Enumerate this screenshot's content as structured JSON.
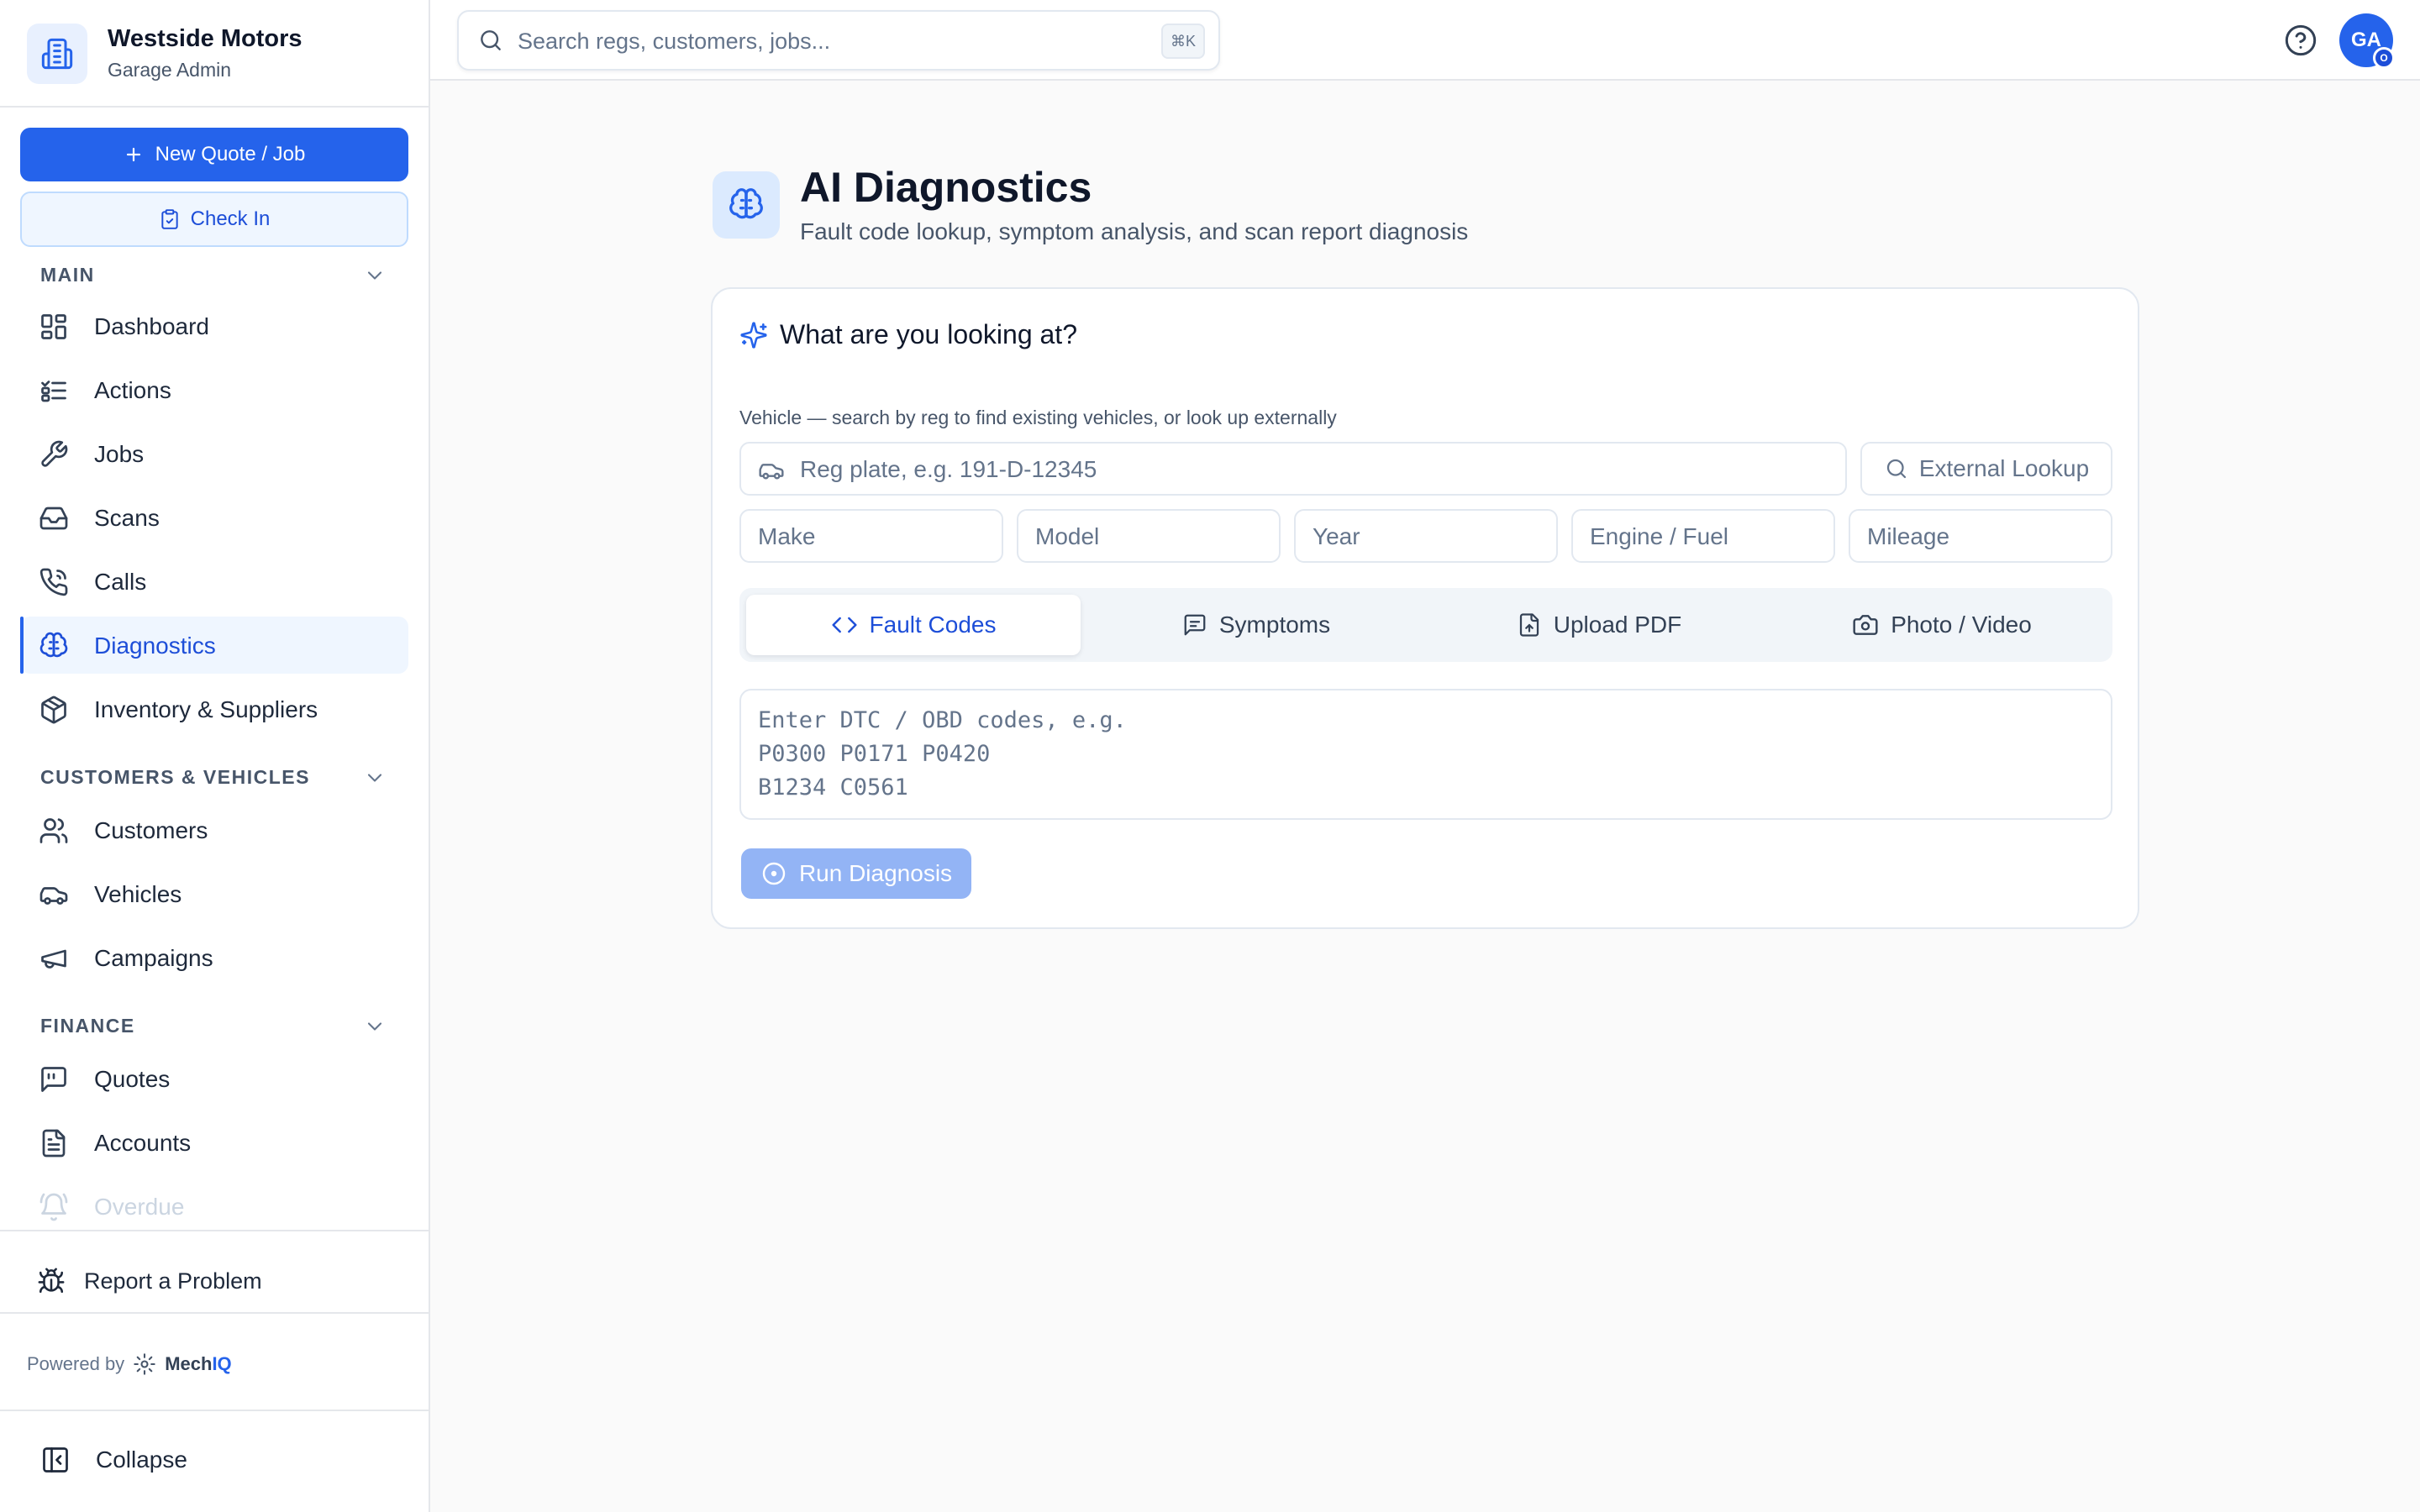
{
  "brand": {
    "name": "Westside Motors",
    "subtitle": "Garage Admin"
  },
  "actions": {
    "new_quote": "New Quote / Job",
    "check_in": "Check In"
  },
  "sidebar": {
    "sections": [
      {
        "label": "MAIN",
        "items": [
          {
            "label": "Dashboard",
            "icon": "dashboard-icon"
          },
          {
            "label": "Actions",
            "icon": "list-checks-icon"
          },
          {
            "label": "Jobs",
            "icon": "wrench-icon"
          },
          {
            "label": "Scans",
            "icon": "inbox-icon"
          },
          {
            "label": "Calls",
            "icon": "phone-icon"
          },
          {
            "label": "Diagnostics",
            "icon": "brain-icon",
            "active": true
          },
          {
            "label": "Inventory & Suppliers",
            "icon": "package-icon"
          }
        ]
      },
      {
        "label": "CUSTOMERS & VEHICLES",
        "items": [
          {
            "label": "Customers",
            "icon": "users-icon"
          },
          {
            "label": "Vehicles",
            "icon": "car-icon"
          },
          {
            "label": "Campaigns",
            "icon": "megaphone-icon"
          }
        ]
      },
      {
        "label": "FINANCE",
        "items": [
          {
            "label": "Quotes",
            "icon": "message-quote-icon"
          },
          {
            "label": "Accounts",
            "icon": "file-text-icon"
          },
          {
            "label": "Overdue",
            "icon": "bell-icon"
          }
        ]
      }
    ],
    "report_problem": "Report a Problem",
    "powered_by": "Powered by",
    "powered_brand_a": "Mech",
    "powered_brand_b": "IQ",
    "collapse": "Collapse"
  },
  "topbar": {
    "search_placeholder": "Search regs, customers, jobs...",
    "shortcut": "⌘K",
    "avatar_initials": "GA",
    "avatar_badge": "O"
  },
  "page": {
    "title": "AI Diagnostics",
    "subtitle": "Fault code lookup, symptom analysis, and scan report diagnosis"
  },
  "card": {
    "title": "What are you looking at?",
    "vehicle_hint": "Vehicle — search by reg to find existing vehicles, or look up externally",
    "reg_placeholder": "Reg plate, e.g. 191-D-12345",
    "external_lookup": "External Lookup",
    "make_placeholder": "Make",
    "model_placeholder": "Model",
    "year_placeholder": "Year",
    "engine_placeholder": "Engine / Fuel",
    "mileage_placeholder": "Mileage",
    "tabs": [
      {
        "label": "Fault Codes",
        "icon": "code-icon",
        "active": true
      },
      {
        "label": "Symptoms",
        "icon": "message-icon"
      },
      {
        "label": "Upload PDF",
        "icon": "file-upload-icon"
      },
      {
        "label": "Photo / Video",
        "icon": "camera-icon"
      }
    ],
    "codes_placeholder": "Enter DTC / OBD codes, e.g.\nP0300 P0171 P0420\nB1234 C0561",
    "run_button": "Run Diagnosis"
  },
  "colors": {
    "accent": "#2563eb",
    "accent_light": "#eff6ff",
    "disabled_button": "#93b4f5"
  }
}
